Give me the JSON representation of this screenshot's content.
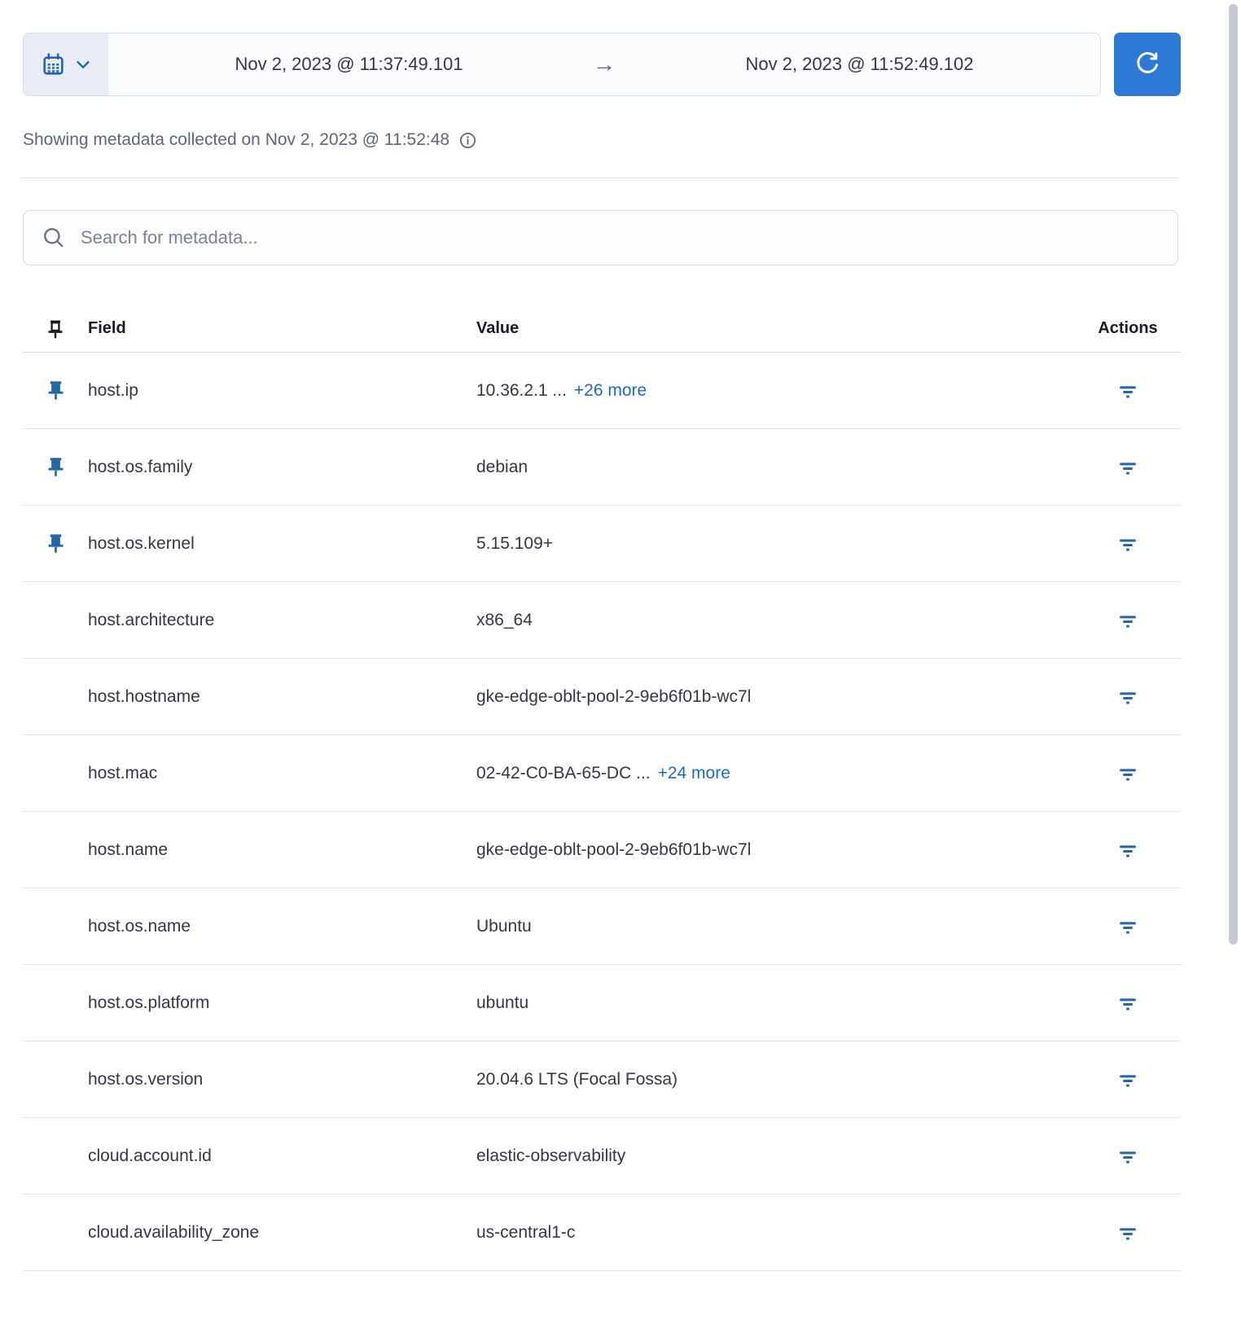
{
  "time_picker": {
    "start": "Nov 2, 2023 @ 11:37:49.101",
    "end": "Nov 2, 2023 @ 11:52:49.102",
    "range_arrow": "→"
  },
  "metadata_note": "Showing metadata collected on Nov 2, 2023 @ 11:52:48",
  "search": {
    "placeholder": "Search for metadata..."
  },
  "table": {
    "headers": {
      "field": "Field",
      "value": "Value",
      "actions": "Actions"
    },
    "rows": [
      {
        "field": "host.ip",
        "value": "10.36.2.1 ...",
        "more": "+26 more",
        "pinned": true
      },
      {
        "field": "host.os.family",
        "value": "debian",
        "more": "",
        "pinned": true
      },
      {
        "field": "host.os.kernel",
        "value": "5.15.109+",
        "more": "",
        "pinned": true
      },
      {
        "field": "host.architecture",
        "value": "x86_64",
        "more": "",
        "pinned": false
      },
      {
        "field": "host.hostname",
        "value": "gke-edge-oblt-pool-2-9eb6f01b-wc7l",
        "more": "",
        "pinned": false
      },
      {
        "field": "host.mac",
        "value": "02-42-C0-BA-65-DC ...",
        "more": "+24 more",
        "pinned": false
      },
      {
        "field": "host.name",
        "value": "gke-edge-oblt-pool-2-9eb6f01b-wc7l",
        "more": "",
        "pinned": false
      },
      {
        "field": "host.os.name",
        "value": "Ubuntu",
        "more": "",
        "pinned": false
      },
      {
        "field": "host.os.platform",
        "value": "ubuntu",
        "more": "",
        "pinned": false
      },
      {
        "field": "host.os.version",
        "value": "20.04.6 LTS (Focal Fossa)",
        "more": "",
        "pinned": false
      },
      {
        "field": "cloud.account.id",
        "value": "elastic-observability",
        "more": "",
        "pinned": false
      },
      {
        "field": "cloud.availability_zone",
        "value": "us-central1-c",
        "more": "",
        "pinned": false
      }
    ]
  },
  "colors": {
    "button_blue": "#2e79d6",
    "link_blue": "#1b6ac9",
    "pin_blue": "#2565a3",
    "filter_icon_blue": "#2468a8",
    "icon_blue": "#1d62b8",
    "text_dark": "#343741",
    "text_muted": "#5f6673",
    "divider": "#dee3ed"
  }
}
